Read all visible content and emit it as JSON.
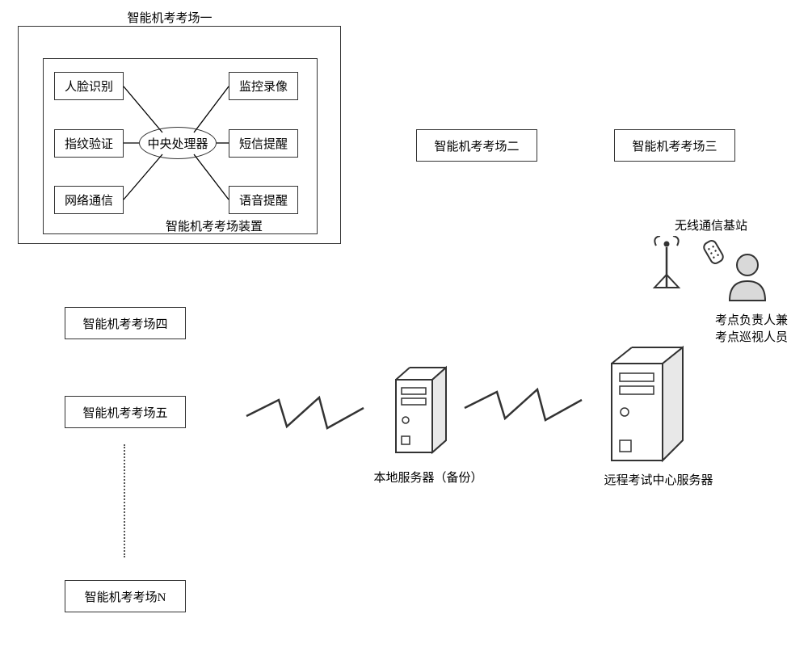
{
  "room1_title": "智能机考考场一",
  "device_label": "智能机考考场装置",
  "cpu": "中央处理器",
  "modules": {
    "face": "人脸识别",
    "fingerprint": "指纹验证",
    "network": "网络通信",
    "cctv": "监控录像",
    "sms": "短信提醒",
    "voice": "语音提醒"
  },
  "rooms": {
    "r2": "智能机考考场二",
    "r3": "智能机考考场三",
    "r4": "智能机考考场四",
    "r5": "智能机考考场五",
    "rN": "智能机考考场N"
  },
  "local_server": "本地服务器（备份）",
  "remote_server": "远程考试中心服务器",
  "base_station": "无线通信基站",
  "inspector": "考点负责人兼\n考点巡视人员"
}
